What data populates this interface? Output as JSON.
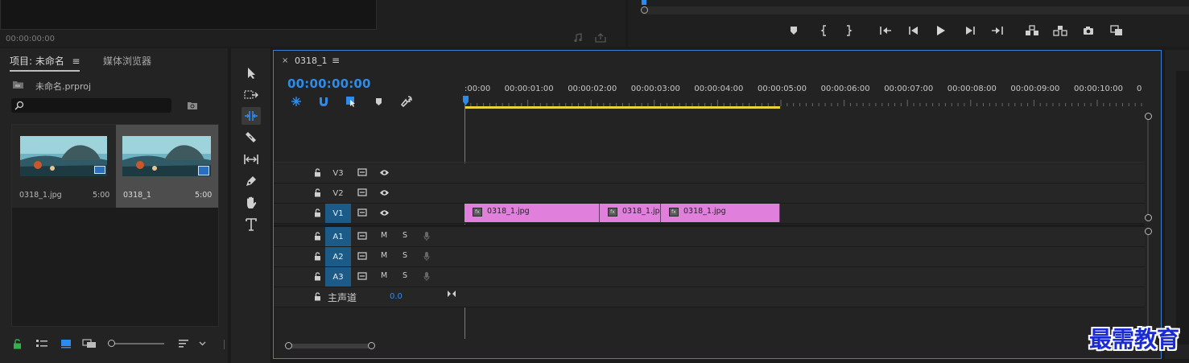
{
  "source_monitor": {
    "timecode": "00:00:00:00"
  },
  "project_panel": {
    "tab_project": "项目: 未命名",
    "tab_media_browser": "媒体浏览器",
    "project_file": "未命名.prproj",
    "search_placeholder": "",
    "items": [
      {
        "name": "0318_1.jpg",
        "duration": "5:00"
      },
      {
        "name": "0318_1",
        "duration": "5:00"
      }
    ]
  },
  "timeline": {
    "sequence_name": "0318_1",
    "timecode": "00:00:00:00",
    "ruler_labels": [
      ":00:00",
      "00:00:01:00",
      "00:00:02:00",
      "00:00:03:00",
      "00:00:04:00",
      "00:00:05:00",
      "00:00:06:00",
      "00:00:07:00",
      "00:00:08:00",
      "00:00:09:00",
      "00:00:10:00",
      "0"
    ],
    "video_tracks": [
      {
        "id": "V3",
        "active": false
      },
      {
        "id": "V2",
        "active": false
      },
      {
        "id": "V1",
        "active": true
      }
    ],
    "audio_tracks": [
      {
        "id": "A1",
        "m": "M",
        "s": "S"
      },
      {
        "id": "A2",
        "m": "M",
        "s": "S"
      },
      {
        "id": "A3",
        "m": "M",
        "s": "S"
      }
    ],
    "master": {
      "label": "主声道",
      "value": "0.0"
    },
    "clips": [
      {
        "label": "0318_1.jpg"
      },
      {
        "label": "0318_1.jp"
      },
      {
        "label": "0318_1.jpg"
      }
    ]
  },
  "watermark": {
    "text": "最需教育"
  },
  "colors": {
    "accent_blue": "#2d8ceb",
    "clip_pink": "#e080dc",
    "work_area_yellow": "#e8d33a",
    "track_active": "#1c5a87"
  }
}
